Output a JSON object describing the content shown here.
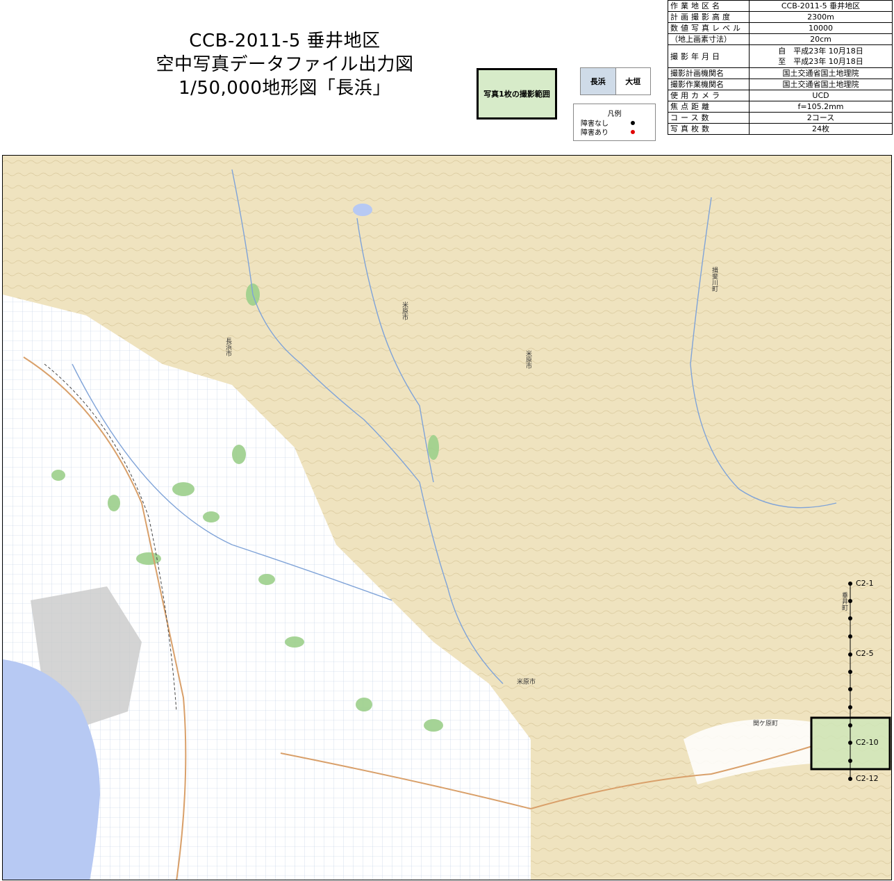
{
  "title": {
    "line1": "CCB-2011-5 垂井地区",
    "line2": "空中写真データファイル出力図",
    "line3": "1/50,000地形図「長浜」"
  },
  "coverage_label": "写真1枚の撮影範囲",
  "sheet_index": {
    "current": "長浜",
    "neighbor": "大垣"
  },
  "legend": {
    "title": "凡例",
    "items": [
      {
        "label": "障害なし",
        "color": "#000000"
      },
      {
        "label": "障害あり",
        "color": "#e00000"
      }
    ]
  },
  "info": [
    {
      "key": "作業地区名",
      "value": "CCB-2011-5 垂井地区"
    },
    {
      "key": "計画撮影高度",
      "value": "2300m"
    },
    {
      "key": "数値写真レベル",
      "value": "10000"
    },
    {
      "key": "（地上画素寸法）",
      "value": "20cm"
    },
    {
      "key": "撮影年月日",
      "value": "自　平成23年 10月18日",
      "value2": "至　平成23年 10月18日"
    },
    {
      "key": "撮影計画機関名",
      "value": "国土交通省国土地理院"
    },
    {
      "key": "撮影作業機関名",
      "value": "国土交通省国土地理院"
    },
    {
      "key": "使用カメラ",
      "value": "UCD"
    },
    {
      "key": "焦点距離",
      "value": "f=105.2mm"
    },
    {
      "key": "コース数",
      "value": "2コース"
    },
    {
      "key": "写真枚数",
      "value": "24枚"
    }
  ],
  "map": {
    "colors": {
      "terrain": "#efe3bf",
      "urban": "#ffffff",
      "lake": "#b7c9f3",
      "forest": "#9ccf8b",
      "coverage": "#cfe6b8"
    },
    "place_names": [
      "長浜市",
      "米原市",
      "米原市",
      "揖斐川町",
      "垂井町",
      "関ケ原町",
      "米原市"
    ],
    "flight_line": {
      "course": "C2",
      "photo_count": 12,
      "labels": [
        "C2-1",
        "C2-5",
        "C2-10",
        "C2-12"
      ]
    }
  }
}
